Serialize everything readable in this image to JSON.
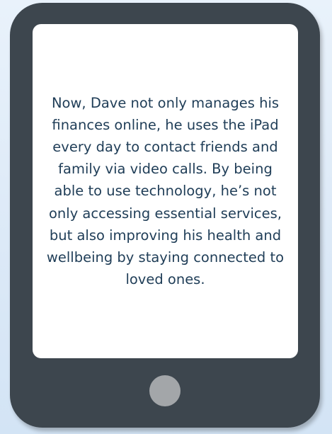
{
  "tablet": {
    "screen_text": "Now, Dave not only manages his finances online, he uses the iPad every day to contact friends and family via video calls. By being able to use technology, he’s not only accessing essential services, but also improving his health and wellbeing by staying connected to loved ones."
  },
  "colors": {
    "tablet_body": "#3d464e",
    "screen": "#ffffff",
    "text": "#1f3d57",
    "home_button": "#a3a6a9",
    "background": "#dce9f7"
  }
}
